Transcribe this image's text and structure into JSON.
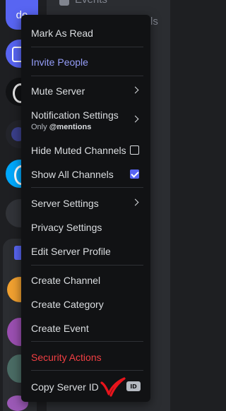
{
  "server_rail": {
    "first_server_label": "de"
  },
  "background": {
    "events_label": "Events",
    "channel_fragment": "ls"
  },
  "context_menu": {
    "mark_as_read": "Mark As Read",
    "invite_people": "Invite People",
    "mute_server": "Mute Server",
    "notification_settings": "Notification Settings",
    "notification_sub_prefix": "Only ",
    "notification_sub_value": "@mentions",
    "hide_muted_channels": "Hide Muted Channels",
    "hide_muted_checked": false,
    "show_all_channels": "Show All Channels",
    "show_all_checked": true,
    "server_settings": "Server Settings",
    "privacy_settings": "Privacy Settings",
    "edit_server_profile": "Edit Server Profile",
    "create_channel": "Create Channel",
    "create_category": "Create Category",
    "create_event": "Create Event",
    "security_actions": "Security Actions",
    "copy_server_id": "Copy Server ID",
    "id_badge": "ID"
  },
  "colors": {
    "accent_blue": "#949cf7",
    "danger_red": "#f23f43",
    "checkbox_checked": "#5865f2",
    "menu_bg": "#111214",
    "annotation_red": "#e8141c"
  }
}
